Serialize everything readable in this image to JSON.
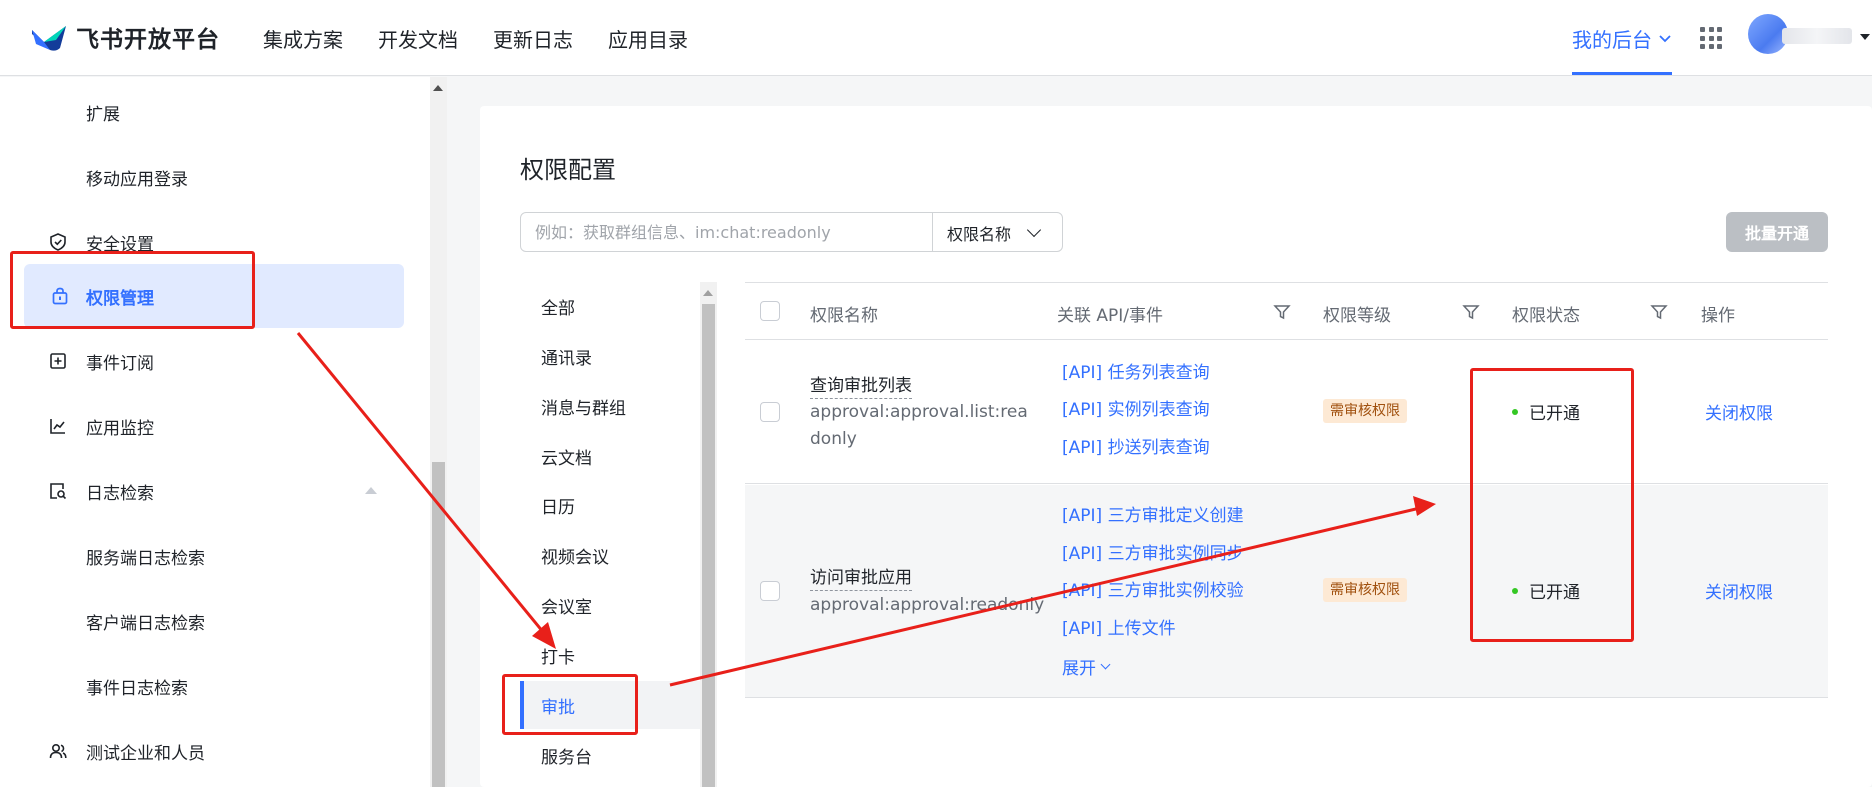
{
  "topbar": {
    "brand": "飞书开放平台",
    "nav": [
      "集成方案",
      "开发文档",
      "更新日志",
      "应用目录"
    ],
    "my_backend": "我的后台"
  },
  "sidebar": {
    "items": [
      {
        "label": "扩展",
        "icon": ""
      },
      {
        "label": "移动应用登录",
        "icon": ""
      },
      {
        "label": "安全设置",
        "icon": "shield-icon"
      },
      {
        "label": "权限管理",
        "icon": "lock-bag-icon",
        "active": true
      },
      {
        "label": "事件订阅",
        "icon": "plus-box-icon"
      },
      {
        "label": "应用监控",
        "icon": "line-chart-icon"
      },
      {
        "label": "日志检索",
        "icon": "log-search-icon",
        "expanded": true
      },
      {
        "label": "服务端日志检索",
        "icon": ""
      },
      {
        "label": "客户端日志检索",
        "icon": ""
      },
      {
        "label": "事件日志检索",
        "icon": ""
      },
      {
        "label": "测试企业和人员",
        "icon": "users-icon"
      }
    ]
  },
  "main": {
    "title": "权限配置",
    "search": {
      "placeholder": "例如：获取群组信息、im:chat:readonly",
      "value": "",
      "select_value": "权限名称"
    },
    "batch_button": "批量开通",
    "categories": [
      "全部",
      "通讯录",
      "消息与群组",
      "云文档",
      "日历",
      "视频会议",
      "会议室",
      "打卡",
      "审批",
      "服务台"
    ],
    "active_category": "审批",
    "table": {
      "headers": {
        "name": "权限名称",
        "api": "关联 API/事件",
        "level": "权限等级",
        "status": "权限状态",
        "action": "操作"
      },
      "rows": [
        {
          "name": "查询审批列表",
          "code": "approval:approval.list:readonly",
          "apis": [
            "[API] 任务列表查询",
            "[API] 实例列表查询",
            "[API] 抄送列表查询"
          ],
          "level": "需审核权限",
          "status": "已开通",
          "action": "关闭权限"
        },
        {
          "name": "访问审批应用",
          "code": "approval:approval:readonly",
          "apis": [
            "[API] 三方审批定义创建",
            "[API] 三方审批实例同步",
            "[API] 三方审批实例校验",
            "[API] 上传文件"
          ],
          "expand": "展开",
          "level": "需审核权限",
          "status": "已开通",
          "action": "关闭权限"
        }
      ]
    }
  },
  "colors": {
    "accent": "#3370ff",
    "annotation_red": "#e8201a",
    "status_green": "#34c724",
    "badge_bg": "#fde9d4"
  }
}
